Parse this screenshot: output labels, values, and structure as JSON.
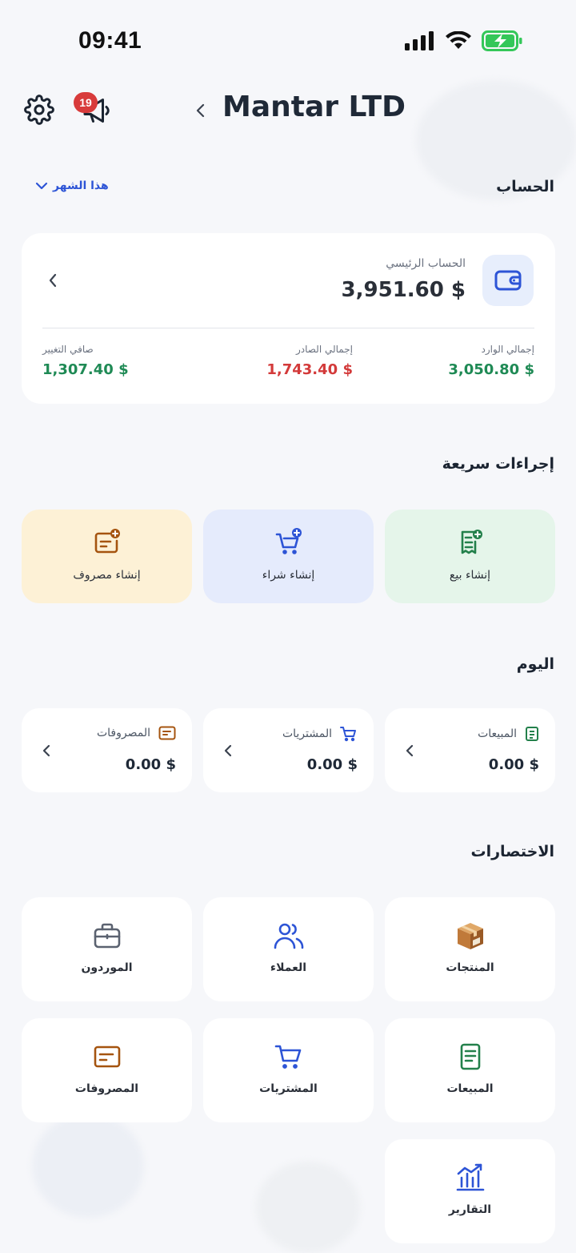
{
  "status_bar": {
    "time": "09:41"
  },
  "header": {
    "title": "Mantar LTD",
    "notification_count": "19"
  },
  "account_section": {
    "heading": "الحساب",
    "period_label": "هذا الشهر",
    "main_account_label": "الحساب الرئيسي",
    "balance": "3,951.60 $",
    "stats": [
      {
        "label": "إجمالي الوارد",
        "value": "3,050.80 $",
        "color": "#1f8a55"
      },
      {
        "label": "إجمالي الصادر",
        "value": "1,743.40 $",
        "color": "#d33a3a"
      },
      {
        "label": "صافي التغيير",
        "value": "1,307.40 $",
        "color": "#1f8a55"
      }
    ]
  },
  "quick_actions": {
    "heading": "إجراءات سريعة",
    "items": [
      {
        "label": "إنشاء بيع",
        "icon": "receipt-plus-icon",
        "bg": "#e5f5ea",
        "color": "#23804b"
      },
      {
        "label": "إنشاء شراء",
        "icon": "cart-plus-icon",
        "bg": "#e5ebfc",
        "color": "#2d54d6"
      },
      {
        "label": "إنشاء مصروف",
        "icon": "expense-plus-icon",
        "bg": "#fdf1d6",
        "color": "#a5540f"
      }
    ]
  },
  "today": {
    "heading": "اليوم",
    "items": [
      {
        "label": "المبيعات",
        "value": "0.00 $",
        "icon": "receipt-icon"
      },
      {
        "label": "المشتريات",
        "value": "0.00 $",
        "icon": "cart-icon"
      },
      {
        "label": "المصروفات",
        "value": "0.00 $",
        "icon": "expense-icon"
      }
    ]
  },
  "shortcuts": {
    "heading": "الاختصارات",
    "items": [
      {
        "label": "المنتجات",
        "icon": "package-icon"
      },
      {
        "label": "العملاء",
        "icon": "users-icon"
      },
      {
        "label": "الموردون",
        "icon": "briefcase-icon"
      },
      {
        "label": "المبيعات",
        "icon": "receipt-icon"
      },
      {
        "label": "المشتريات",
        "icon": "cart-icon"
      },
      {
        "label": "المصروفات",
        "icon": "expense-icon"
      },
      {
        "label": "التقارير",
        "icon": "chart-icon"
      }
    ]
  },
  "colors": {
    "accent": "#2d54d6",
    "positive": "#1f8a55",
    "negative": "#d33a3a",
    "badge": "#d83b3b"
  }
}
